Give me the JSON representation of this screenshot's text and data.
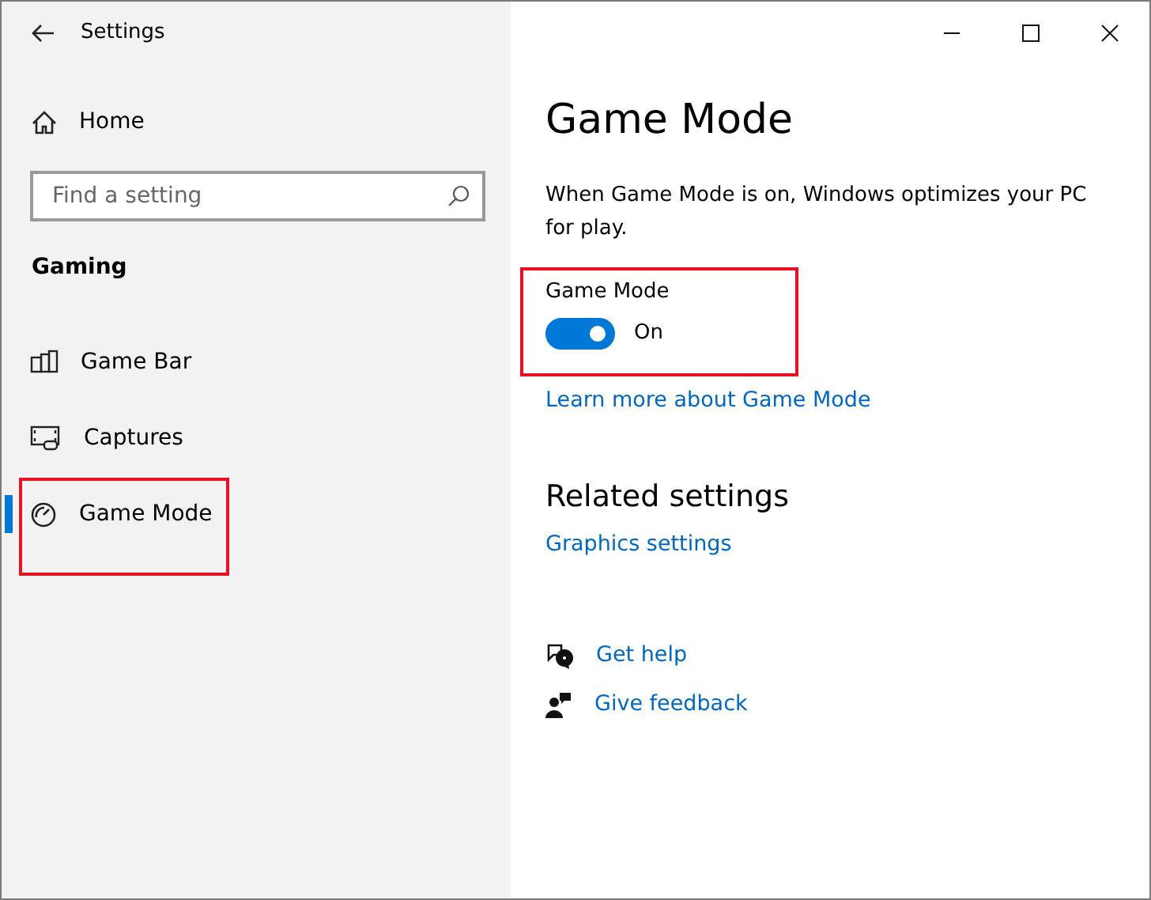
{
  "window": {
    "title": "Settings"
  },
  "sidebar": {
    "home": "Home",
    "search": {
      "placeholder": "Find a setting"
    },
    "section": "Gaming",
    "items": [
      {
        "label": "Game Bar",
        "selected": false,
        "highlighted": false
      },
      {
        "label": "Captures",
        "selected": false,
        "highlighted": false
      },
      {
        "label": "Game Mode",
        "selected": true,
        "highlighted": true
      }
    ]
  },
  "content": {
    "title": "Game Mode",
    "description": "When Game Mode is on, Windows optimizes your PC for play.",
    "toggle": {
      "label": "Game Mode",
      "on": true,
      "state_text": "On",
      "highlighted": true
    },
    "learn_more": "Learn more about Game Mode",
    "related": {
      "title": "Related settings",
      "links": [
        "Graphics settings"
      ]
    },
    "help": [
      {
        "label": "Get help"
      },
      {
        "label": "Give feedback"
      }
    ]
  }
}
